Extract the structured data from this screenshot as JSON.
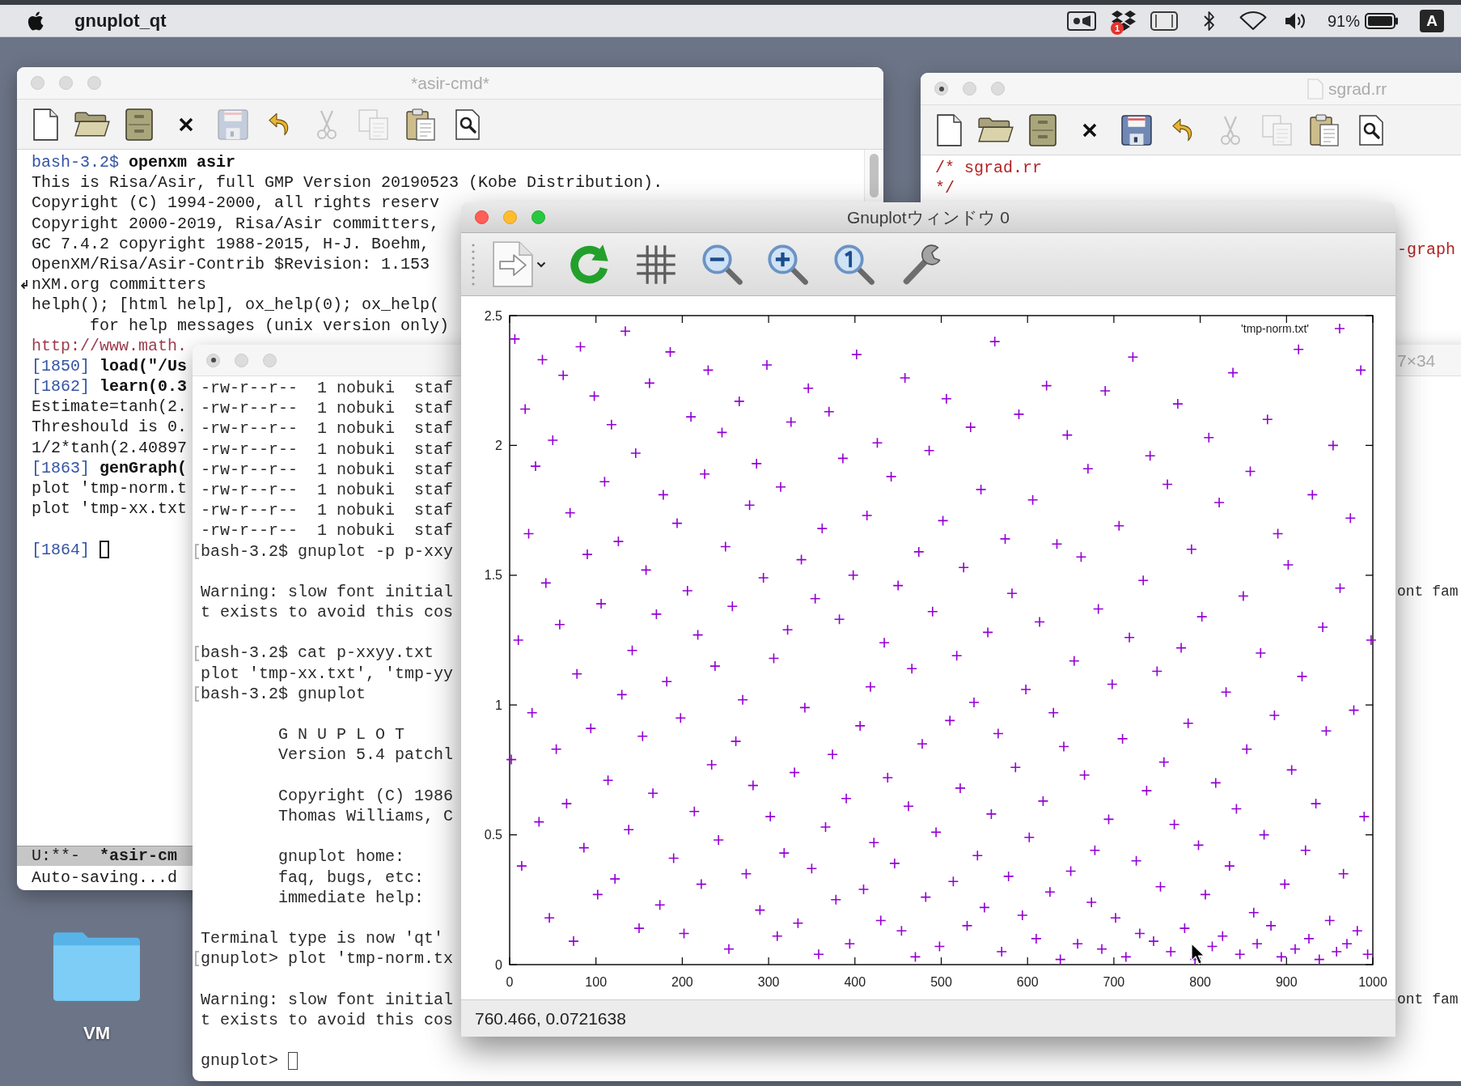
{
  "menu_bar": {
    "app_name": "gnuplot_qt",
    "dropbox_badge": "1",
    "battery_percent": "91%",
    "input_source": "A"
  },
  "desktop_items": [
    {
      "label": "VM"
    }
  ],
  "asir_window": {
    "title": "*asir-cmd*",
    "active": false,
    "edited": false,
    "toolbar": [
      {
        "kind": "new",
        "disabled": false
      },
      {
        "kind": "open",
        "disabled": false
      },
      {
        "kind": "directory",
        "disabled": false
      },
      {
        "kind": "close",
        "disabled": false
      },
      {
        "kind": "save",
        "disabled": true
      },
      {
        "kind": "undo",
        "disabled": false
      },
      {
        "kind": "cut",
        "disabled": true
      },
      {
        "kind": "copy",
        "disabled": true
      },
      {
        "kind": "paste",
        "disabled": false
      },
      {
        "kind": "search",
        "disabled": false
      }
    ],
    "blocks": [
      {
        "lines": [
          {
            "wrapped": false,
            "segments": [
              {
                "kind": "prompt",
                "text": "bash-3.2$ "
              },
              {
                "kind": "input",
                "text": "openxm asir"
              }
            ]
          },
          {
            "wrapped": false,
            "segments": [
              {
                "kind": "plain",
                "text": "This is Risa/Asir, full GMP Version 20190523 (Kobe Distribution)."
              }
            ]
          },
          {
            "wrapped": false,
            "segments": [
              {
                "kind": "plain",
                "text": "Copyright (C) 1994-2000, all rights reserv"
              }
            ]
          },
          {
            "wrapped": false,
            "segments": [
              {
                "kind": "plain",
                "text": "Copyright 2000-2019, Risa/Asir committers,"
              }
            ]
          },
          {
            "wrapped": false,
            "segments": [
              {
                "kind": "plain",
                "text": "GC 7.4.2 copyright 1988-2015, H-J. Boehm,"
              }
            ]
          },
          {
            "wrapped": false,
            "segments": [
              {
                "kind": "plain",
                "text": "OpenXM/Risa/Asir-Contrib $Revision: 1.153"
              }
            ]
          },
          {
            "wrapped": true,
            "segments": [
              {
                "kind": "plain",
                "text": "nXM.org committers"
              }
            ]
          },
          {
            "wrapped": false,
            "segments": [
              {
                "kind": "plain",
                "text": "helph(); [html help], ox_help(0); ox_help("
              }
            ]
          },
          {
            "wrapped": false,
            "segments": [
              {
                "kind": "plain",
                "text": "      for help messages (unix version only)"
              }
            ]
          },
          {
            "wrapped": false,
            "segments": [
              {
                "kind": "link",
                "text": "http://www.math."
              }
            ]
          },
          {
            "wrapped": false,
            "segments": [
              {
                "kind": "prompt",
                "text": "[1850] "
              },
              {
                "kind": "input",
                "text": "load(\"/Us"
              }
            ]
          },
          {
            "wrapped": false,
            "segments": [
              {
                "kind": "prompt",
                "text": "[1862] "
              },
              {
                "kind": "input",
                "text": "learn(0.3"
              }
            ]
          },
          {
            "wrapped": false,
            "segments": [
              {
                "kind": "plain",
                "text": "Estimate=tanh(2."
              }
            ]
          },
          {
            "wrapped": false,
            "segments": [
              {
                "kind": "plain",
                "text": "Threshould is 0."
              }
            ]
          },
          {
            "wrapped": false,
            "segments": [
              {
                "kind": "plain",
                "text": "1/2*tanh(2.40897"
              }
            ]
          },
          {
            "wrapped": false,
            "segments": [
              {
                "kind": "prompt",
                "text": "[1863] "
              },
              {
                "kind": "input",
                "text": "genGraph("
              }
            ]
          },
          {
            "wrapped": false,
            "segments": [
              {
                "kind": "plain",
                "text": "plot 'tmp-norm.t"
              }
            ]
          },
          {
            "wrapped": false,
            "segments": [
              {
                "kind": "plain",
                "text": "plot 'tmp-xx.txt"
              }
            ]
          }
        ]
      },
      {
        "lines": [
          {
            "wrapped": false,
            "segments": [
              {
                "kind": "prompt",
                "text": "[1864] "
              },
              {
                "kind": "cursor"
              }
            ]
          }
        ]
      }
    ],
    "mode_line": [
      {
        "kind": "plain",
        "text": "U:**-  "
      },
      {
        "kind": "bold",
        "text": "*asir-cm"
      }
    ],
    "echo_area": "Auto-saving...d"
  },
  "sgrad_window": {
    "title": "sgrad.rr",
    "active": false,
    "edited": true,
    "toolbar": [
      {
        "kind": "new",
        "disabled": false
      },
      {
        "kind": "open",
        "disabled": false
      },
      {
        "kind": "directory",
        "disabled": false
      },
      {
        "kind": "close",
        "disabled": false
      },
      {
        "kind": "save",
        "disabled": false
      },
      {
        "kind": "undo",
        "disabled": false
      },
      {
        "kind": "cut",
        "disabled": true
      },
      {
        "kind": "copy",
        "disabled": true
      },
      {
        "kind": "paste",
        "disabled": false
      },
      {
        "kind": "search",
        "disabled": false
      }
    ],
    "lines": [
      {
        "text": "/* sgrad.rr"
      },
      {
        "text": "*/"
      }
    ],
    "right_fragments": [
      {
        "text": "-graph"
      }
    ]
  },
  "terminal_window": {
    "title": "7×34",
    "active": false,
    "edited": true,
    "blocks": [
      {
        "lines": [
          {
            "marked": false,
            "text": "-rw-r--r--  1 nobuki  staf"
          },
          {
            "marked": false,
            "text": "-rw-r--r--  1 nobuki  staf"
          },
          {
            "marked": false,
            "text": "-rw-r--r--  1 nobuki  staf"
          },
          {
            "marked": false,
            "text": "-rw-r--r--  1 nobuki  staf"
          },
          {
            "marked": false,
            "text": "-rw-r--r--  1 nobuki  staf"
          },
          {
            "marked": false,
            "text": "-rw-r--r--  1 nobuki  staf"
          },
          {
            "marked": false,
            "text": "-rw-r--r--  1 nobuki  staf"
          },
          {
            "marked": false,
            "text": "-rw-r--r--  1 nobuki  staf"
          },
          {
            "marked": true,
            "text": "bash-3.2$ gnuplot -p p-xxy"
          }
        ]
      },
      {
        "lines": [
          {
            "marked": false,
            "text": "Warning: slow font initial",
            "right": "ont fam"
          },
          {
            "marked": false,
            "text": "t exists to avoid this cos"
          }
        ]
      },
      {
        "lines": [
          {
            "marked": true,
            "text": "bash-3.2$ cat p-xxyy.txt"
          },
          {
            "marked": false,
            "text": "plot 'tmp-xx.txt', 'tmp-yy"
          },
          {
            "marked": true,
            "text": "bash-3.2$ gnuplot"
          }
        ]
      },
      {
        "lines": [
          {
            "marked": false,
            "text": "        G N U P L O T"
          },
          {
            "marked": false,
            "text": "        Version 5.4 patchl"
          }
        ]
      },
      {
        "lines": [
          {
            "marked": false,
            "text": "        Copyright (C) 1986"
          },
          {
            "marked": false,
            "text": "        Thomas Williams, C"
          }
        ]
      },
      {
        "lines": [
          {
            "marked": false,
            "text": "        gnuplot home:"
          },
          {
            "marked": false,
            "text": "        faq, bugs, etc:"
          },
          {
            "marked": false,
            "text": "        immediate help:"
          }
        ]
      },
      {
        "lines": [
          {
            "marked": false,
            "text": "Terminal type is now 'qt'"
          },
          {
            "marked": true,
            "text": "gnuplot> plot 'tmp-norm.tx"
          }
        ]
      },
      {
        "lines": [
          {
            "marked": false,
            "text": "Warning: slow font initial",
            "right": "ont fam"
          },
          {
            "marked": false,
            "text": "t exists to avoid this cos"
          }
        ]
      },
      {
        "lines": [
          {
            "marked": false,
            "text": "gnuplot> ",
            "cursor": true
          }
        ]
      }
    ]
  },
  "gnuplot_window": {
    "title": "Gnuplotウィンドウ 0",
    "active": true,
    "edited": false,
    "chart_data": {
      "type": "scatter",
      "xlim": [
        0,
        1000
      ],
      "ylim": [
        0,
        2.5
      ],
      "xticks": [
        0,
        100,
        200,
        300,
        400,
        500,
        600,
        700,
        800,
        900,
        1000
      ],
      "yticks": [
        0,
        0.5,
        1,
        1.5,
        2,
        2.5
      ],
      "x": [
        2,
        6,
        10,
        14,
        18,
        22,
        26,
        30,
        34,
        38,
        42,
        46,
        50,
        54,
        58,
        62,
        66,
        70,
        74,
        78,
        82,
        86,
        90,
        94,
        98,
        102,
        106,
        110,
        114,
        118,
        122,
        126,
        130,
        134,
        138,
        142,
        146,
        150,
        154,
        158,
        162,
        166,
        170,
        174,
        178,
        182,
        186,
        190,
        194,
        198,
        202,
        206,
        210,
        214,
        218,
        222,
        226,
        230,
        234,
        238,
        242,
        246,
        250,
        254,
        258,
        262,
        266,
        270,
        274,
        278,
        282,
        286,
        290,
        294,
        298,
        302,
        306,
        310,
        314,
        318,
        322,
        326,
        330,
        334,
        338,
        342,
        346,
        350,
        354,
        358,
        362,
        366,
        370,
        374,
        378,
        382,
        386,
        390,
        394,
        398,
        402,
        406,
        410,
        414,
        418,
        422,
        426,
        430,
        434,
        438,
        442,
        446,
        450,
        454,
        458,
        462,
        466,
        470,
        474,
        478,
        482,
        486,
        490,
        494,
        498,
        502,
        506,
        510,
        514,
        518,
        522,
        526,
        530,
        534,
        538,
        542,
        546,
        550,
        554,
        558,
        562,
        566,
        570,
        574,
        578,
        582,
        586,
        590,
        594,
        598,
        602,
        606,
        610,
        614,
        618,
        622,
        626,
        630,
        634,
        638,
        642,
        646,
        650,
        654,
        658,
        662,
        666,
        670,
        674,
        678,
        682,
        686,
        690,
        694,
        698,
        702,
        706,
        710,
        714,
        718,
        722,
        726,
        730,
        734,
        738,
        742,
        746,
        750,
        754,
        758,
        762,
        766,
        770,
        774,
        778,
        782,
        786,
        790,
        794,
        798,
        802,
        806,
        810,
        814,
        818,
        822,
        826,
        830,
        834,
        838,
        842,
        846,
        850,
        854,
        858,
        862,
        866,
        870,
        874,
        878,
        882,
        886,
        890,
        894,
        898,
        902,
        906,
        910,
        914,
        918,
        922,
        926,
        930,
        934,
        938,
        942,
        946,
        950,
        954,
        958,
        962,
        966,
        970,
        974,
        978,
        982,
        986,
        990,
        994,
        998
      ],
      "series": [
        {
          "name": "'tmp-norm.txt'",
          "color": "#9400d3",
          "values": [
            0.79,
            2.41,
            1.25,
            0.38,
            2.14,
            1.66,
            0.97,
            1.92,
            0.55,
            2.33,
            1.47,
            0.18,
            2.02,
            0.83,
            1.31,
            2.27,
            0.62,
            1.74,
            0.09,
            1.12,
            2.38,
            0.45,
            1.58,
            0.91,
            2.19,
            0.27,
            1.39,
            1.86,
            0.71,
            2.08,
            0.33,
            1.63,
            1.04,
            2.44,
            0.52,
            1.21,
            1.97,
            0.14,
            0.88,
            1.52,
            2.24,
            0.66,
            1.35,
            0.23,
            1.81,
            1.09,
            2.36,
            0.41,
            1.7,
            0.95,
            0.12,
            1.44,
            2.11,
            0.59,
            1.27,
            0.31,
            1.89,
            2.29,
            0.77,
            1.15,
            0.48,
            2.05,
            1.61,
            0.06,
            1.38,
            0.86,
            2.17,
            1.02,
            0.35,
            1.77,
            0.69,
            1.93,
            0.21,
            1.49,
            2.31,
            0.57,
            1.18,
            0.11,
            1.84,
            0.43,
            1.29,
            2.09,
            0.74,
            0.16,
            1.56,
            0.99,
            2.22,
            0.37,
            1.41,
            0.04,
            1.68,
            0.53,
            2.13,
            0.81,
            0.25,
            1.33,
            1.95,
            0.64,
            0.08,
            1.5,
            2.35,
            0.92,
            0.29,
            1.73,
            1.07,
            0.47,
            2.01,
            0.17,
            1.24,
            0.72,
            1.88,
            0.39,
            1.46,
            0.13,
            2.26,
            0.61,
            1.14,
            0.03,
            1.59,
            0.85,
            0.26,
            1.98,
            1.36,
            0.51,
            0.07,
            1.71,
            2.18,
            0.94,
            0.32,
            1.19,
            0.68,
            1.53,
            0.15,
            2.07,
            1.01,
            0.42,
            1.83,
            0.22,
            1.28,
            0.58,
            2.4,
            0.89,
            0.05,
            1.64,
            0.34,
            1.43,
            0.76,
            2.12,
            0.19,
            1.06,
            0.49,
            1.79,
            0.1,
            1.32,
            0.63,
            2.23,
            0.28,
            0.97,
            1.62,
            0.02,
            0.84,
            2.04,
            0.36,
            1.17,
            0.08,
            1.57,
            0.73,
            1.91,
            0.24,
            0.44,
            1.37,
            0.06,
            2.21,
            0.56,
            1.08,
            0.18,
            1.69,
            0.87,
            0.03,
            1.26,
            2.34,
            0.4,
            0.12,
            1.48,
            0.67,
            1.96,
            0.09,
            1.13,
            0.3,
            0.78,
            1.85,
            0.05,
            0.54,
            2.16,
            1.22,
            0.14,
            0.93,
            1.6,
            0.02,
            0.46,
            1.34,
            0.27,
            2.03,
            0.07,
            0.7,
            1.78,
            0.11,
            1.05,
            0.38,
            2.28,
            0.6,
            0.04,
            1.42,
            0.83,
            1.9,
            0.2,
            0.08,
            1.2,
            0.5,
            2.1,
            0.15,
            0.96,
            1.66,
            0.03,
            0.31,
            1.54,
            0.75,
            0.06,
            2.37,
            1.11,
            0.44,
            0.1,
            1.81,
            0.62,
            0.02,
            1.3,
            0.9,
            0.17,
            2.0,
            0.05,
            1.45,
            0.35,
            0.08,
            1.72,
            0.98,
            0.13,
            2.29,
            0.57,
            0.04,
            1.25
          ]
        }
      ]
    },
    "status_text": "760.466, 0.0721638"
  }
}
